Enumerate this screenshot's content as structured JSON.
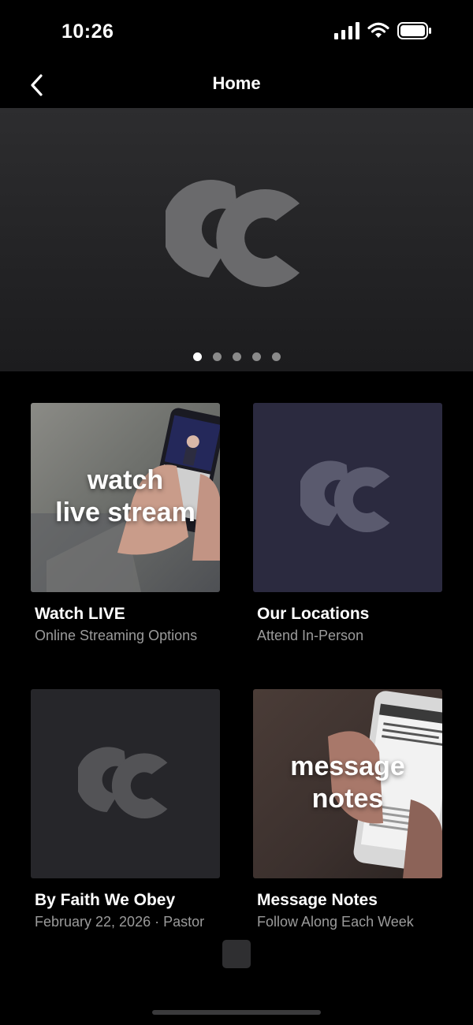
{
  "status_bar": {
    "time": "10:26",
    "icons": [
      "signal-icon",
      "wifi-icon",
      "battery-icon"
    ]
  },
  "nav": {
    "title": "Home",
    "back_icon": "chevron-left-icon"
  },
  "hero": {
    "logo": "cc-logo",
    "pager": {
      "count": 5,
      "active_index": 0
    }
  },
  "cards": [
    {
      "title": "Watch LIVE",
      "subtitle": "Online Streaming Options",
      "overlay_line1": "watch",
      "overlay_line2": "live stream"
    },
    {
      "title": "Our Locations",
      "subtitle": "Attend In-Person"
    },
    {
      "title": "By Faith We Obey",
      "subtitle": "February 22, 2026 · Pastor"
    },
    {
      "title": "Message Notes",
      "subtitle": "Follow Along Each Week",
      "overlay_line1": "message",
      "overlay_line2": "notes"
    }
  ],
  "colors": {
    "background": "#000000",
    "hero": "#2a2a2c",
    "locations_tile": "#2b2a3f",
    "sermon_tile": "#26262a",
    "subtitle": "#9b9b9b"
  }
}
